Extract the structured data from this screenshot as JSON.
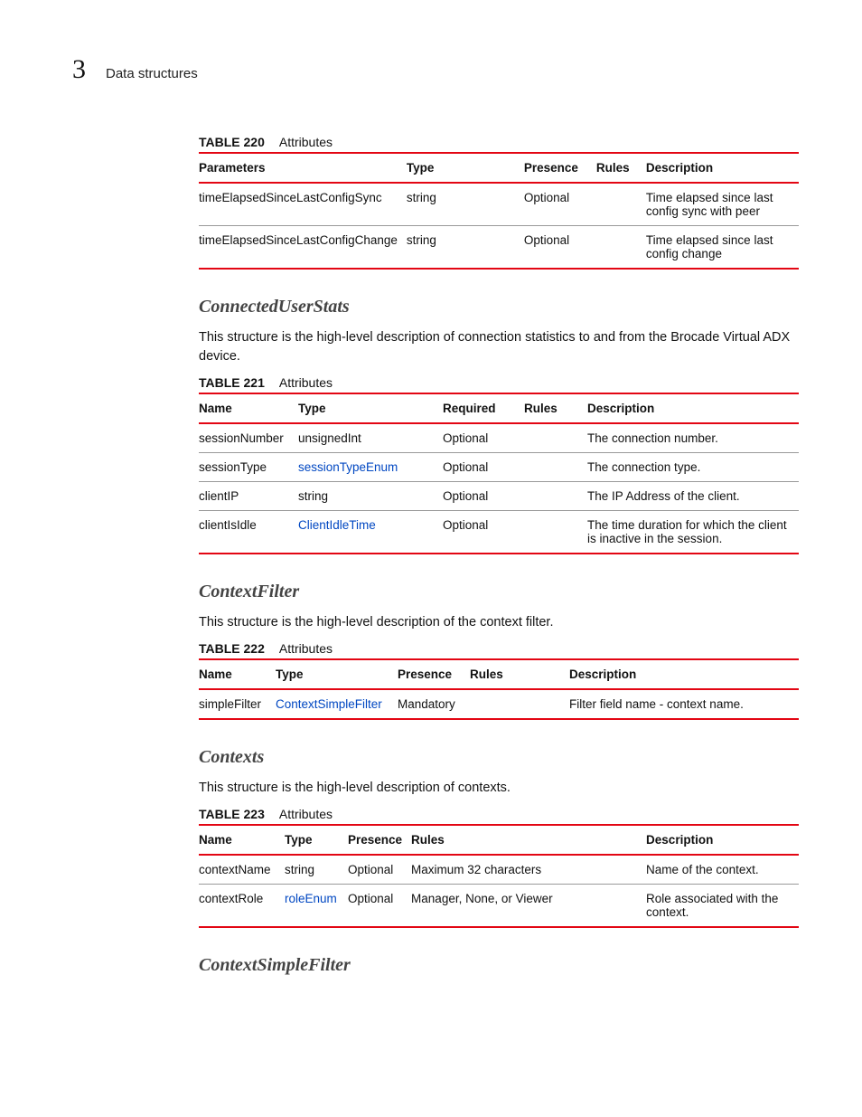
{
  "header": {
    "chapter_number": "3",
    "chapter_title": "Data structures"
  },
  "t220": {
    "label": "TABLE 220",
    "title": "Attributes",
    "cols": [
      "Parameters",
      "Type",
      "Presence",
      "Rules",
      "Description"
    ],
    "rows": [
      {
        "param": "timeElapsedSinceLastConfigSync",
        "type": "string",
        "presence": "Optional",
        "rules": "",
        "desc": "Time elapsed since last config sync with peer"
      },
      {
        "param": "timeElapsedSinceLastConfigChange",
        "type": "string",
        "presence": "Optional",
        "rules": "",
        "desc": "Time elapsed since last config change"
      }
    ]
  },
  "s1": {
    "heading": "ConnectedUserStats",
    "desc": "This structure is the high-level description of connection statistics to and from the Brocade Virtual ADX device."
  },
  "t221": {
    "label": "TABLE 221",
    "title": "Attributes",
    "cols": [
      "Name",
      "Type",
      "Required",
      "Rules",
      "Description"
    ],
    "rows": [
      {
        "name": "sessionNumber",
        "type": "unsignedInt",
        "type_link": false,
        "req": "Optional",
        "rules": "",
        "desc": "The connection number."
      },
      {
        "name": "sessionType",
        "type": "sessionTypeEnum",
        "type_link": true,
        "req": "Optional",
        "rules": "",
        "desc": "The connection type."
      },
      {
        "name": "clientIP",
        "type": "string",
        "type_link": false,
        "req": "Optional",
        "rules": "",
        "desc": "The IP Address of the client."
      },
      {
        "name": "clientIsIdle",
        "type": "ClientIdleTime",
        "type_link": true,
        "req": "Optional",
        "rules": "",
        "desc": "The time duration for which the client is inactive in the session."
      }
    ]
  },
  "s2": {
    "heading": "ContextFilter",
    "desc": "This structure is the high-level description of the context filter."
  },
  "t222": {
    "label": "TABLE 222",
    "title": "Attributes",
    "cols": [
      "Name",
      "Type",
      "Presence",
      "Rules",
      "Description"
    ],
    "rows": [
      {
        "name": "simpleFilter",
        "type": "ContextSimpleFilter",
        "type_link": true,
        "presence": "Mandatory",
        "rules": "",
        "desc": "Filter field name - context name."
      }
    ]
  },
  "s3": {
    "heading": "Contexts",
    "desc": "This structure is the high-level description of contexts."
  },
  "t223": {
    "label": "TABLE 223",
    "title": "Attributes",
    "cols": [
      "Name",
      "Type",
      "Presence",
      "Rules",
      "Description"
    ],
    "rows": [
      {
        "name": "contextName",
        "type": "string",
        "type_link": false,
        "presence": "Optional",
        "rules": "Maximum 32 characters",
        "desc": "Name of the context."
      },
      {
        "name": "contextRole",
        "type": "roleEnum",
        "type_link": true,
        "presence": "Optional",
        "rules": "Manager, None, or Viewer",
        "desc": "Role associated with the context."
      }
    ]
  },
  "s4": {
    "heading": "ContextSimpleFilter"
  }
}
